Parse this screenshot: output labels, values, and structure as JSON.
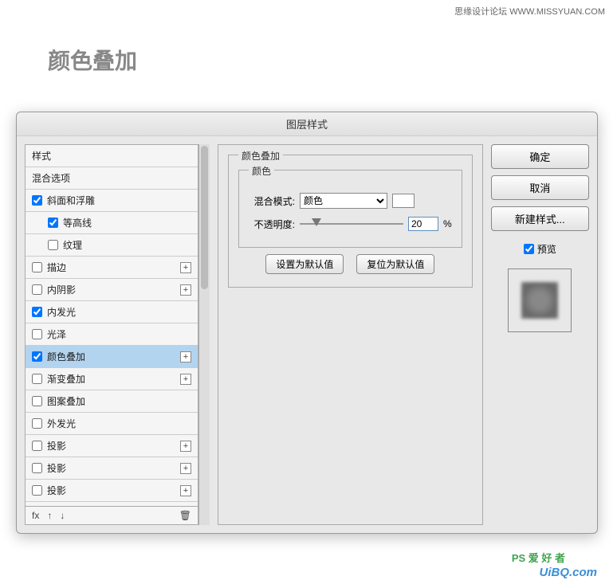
{
  "watermark_top": "思缘设计论坛  WWW.MISSYUAN.COM",
  "page_title": "颜色叠加",
  "dialog": {
    "title": "图层样式",
    "left": {
      "items": [
        {
          "label": "样式",
          "checkbox": false,
          "indent": false,
          "plus": false
        },
        {
          "label": "混合选项",
          "checkbox": false,
          "indent": false,
          "plus": false
        },
        {
          "label": "斜面和浮雕",
          "checkbox": true,
          "checked": true,
          "indent": false,
          "plus": false
        },
        {
          "label": "等高线",
          "checkbox": true,
          "checked": true,
          "indent": true,
          "plus": false
        },
        {
          "label": "纹理",
          "checkbox": true,
          "checked": false,
          "indent": true,
          "plus": false
        },
        {
          "label": "描边",
          "checkbox": true,
          "checked": false,
          "indent": false,
          "plus": true
        },
        {
          "label": "内阴影",
          "checkbox": true,
          "checked": false,
          "indent": false,
          "plus": true
        },
        {
          "label": "内发光",
          "checkbox": true,
          "checked": true,
          "indent": false,
          "plus": false
        },
        {
          "label": "光泽",
          "checkbox": true,
          "checked": false,
          "indent": false,
          "plus": false
        },
        {
          "label": "颜色叠加",
          "checkbox": true,
          "checked": true,
          "indent": false,
          "plus": true,
          "selected": true
        },
        {
          "label": "渐变叠加",
          "checkbox": true,
          "checked": false,
          "indent": false,
          "plus": true
        },
        {
          "label": "图案叠加",
          "checkbox": true,
          "checked": false,
          "indent": false,
          "plus": false
        },
        {
          "label": "外发光",
          "checkbox": true,
          "checked": false,
          "indent": false,
          "plus": false
        },
        {
          "label": "投影",
          "checkbox": true,
          "checked": false,
          "indent": false,
          "plus": true
        },
        {
          "label": "投影",
          "checkbox": true,
          "checked": false,
          "indent": false,
          "plus": true
        },
        {
          "label": "投影",
          "checkbox": true,
          "checked": false,
          "indent": false,
          "plus": true
        }
      ],
      "footer_fx": "fx"
    },
    "center": {
      "section_title": "颜色叠加",
      "subsection_title": "颜色",
      "blend_label": "混合模式:",
      "blend_value": "颜色",
      "opacity_label": "不透明度:",
      "opacity_value": "20",
      "opacity_unit": "%",
      "default_btn": "设置为默认值",
      "reset_btn": "复位为默认值"
    },
    "right": {
      "ok": "确定",
      "cancel": "取消",
      "new_style": "新建样式...",
      "preview": "预览"
    }
  },
  "watermark_bottom1": "PS 爱 好 者",
  "watermark_bottom2": "UiBQ.com"
}
